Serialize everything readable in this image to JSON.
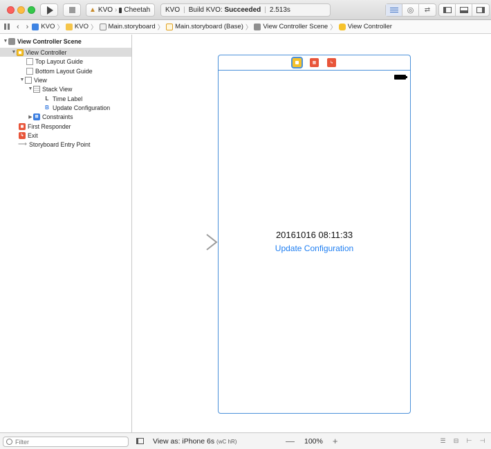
{
  "toolbar": {
    "scheme": {
      "project": "KVO",
      "device": "Cheetah"
    },
    "activity": {
      "target": "KVO",
      "status_prefix": "Build KVO:",
      "status": "Succeeded",
      "duration": "2.513s"
    }
  },
  "jumpbar": {
    "crumbs": [
      "KVO",
      "KVO",
      "Main.storyboard",
      "Main.storyboard (Base)",
      "View Controller Scene",
      "View Controller"
    ]
  },
  "outline": {
    "items": [
      {
        "label": "View Controller Scene",
        "icon": "scene-icon",
        "depth": 0,
        "disclosure": "open"
      },
      {
        "label": "View Controller",
        "icon": "view-controller-icon",
        "depth": 1,
        "disclosure": "open",
        "selected": true
      },
      {
        "label": "Top Layout Guide",
        "icon": "layout-guide-icon",
        "depth": 2
      },
      {
        "label": "Bottom Layout Guide",
        "icon": "layout-guide-icon",
        "depth": 2
      },
      {
        "label": "View",
        "icon": "view-icon",
        "depth": 2,
        "disclosure": "open"
      },
      {
        "label": "Stack View",
        "icon": "stack-view-icon",
        "depth": 3,
        "disclosure": "open"
      },
      {
        "label": "Time Label",
        "icon": "label-icon",
        "depth": 4
      },
      {
        "label": "Update Configuration",
        "icon": "button-icon",
        "depth": 4
      },
      {
        "label": "Constraints",
        "icon": "constraints-icon",
        "depth": 3,
        "disclosure": "closed"
      },
      {
        "label": "First Responder",
        "icon": "first-responder-icon",
        "depth": 1
      },
      {
        "label": "Exit",
        "icon": "exit-icon",
        "depth": 1
      },
      {
        "label": "Storyboard Entry Point",
        "icon": "entry-point-icon",
        "depth": 1
      }
    ]
  },
  "canvas": {
    "time_label": "20161016 08:11:33",
    "button_label": "Update Configuration"
  },
  "bottombar": {
    "filter_placeholder": "Filter",
    "view_as": "View as: iPhone 6s",
    "size_class_w": "wC",
    "size_class_h": "hR",
    "zoom": "100%",
    "zoom_out": "—",
    "zoom_in": "+"
  },
  "colors": {
    "accent": "#4a90d9",
    "button_text": "#1e7ef2",
    "view_controller": "#f6c22b",
    "first_responder": "#e8553a"
  }
}
